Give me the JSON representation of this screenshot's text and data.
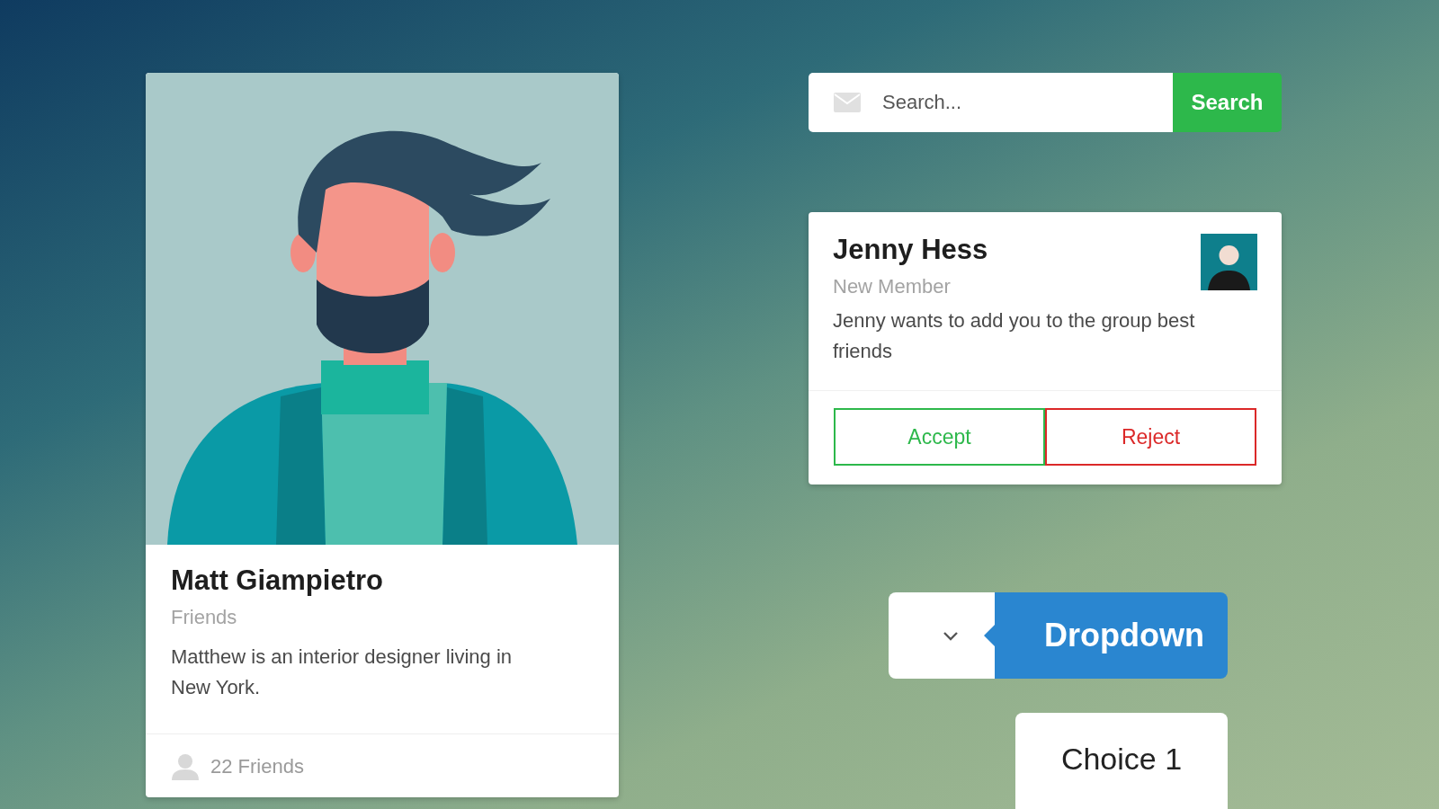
{
  "profile_card": {
    "name": "Matt Giampietro",
    "meta": "Friends",
    "description": "Matthew is an interior designer living in New York.",
    "friends_count": "22 Friends"
  },
  "search": {
    "placeholder": "Search...",
    "button": "Search"
  },
  "request_card": {
    "name": "Jenny Hess",
    "meta": "New Member",
    "message": "Jenny wants to add you to the group best friends",
    "actions": [
      {
        "label": "Accept",
        "kind": "positive"
      },
      {
        "label": "Reject",
        "kind": "negative"
      }
    ]
  },
  "dropdown": {
    "label": "Dropdown",
    "expanded": true,
    "options": [
      "Choice 1"
    ]
  }
}
